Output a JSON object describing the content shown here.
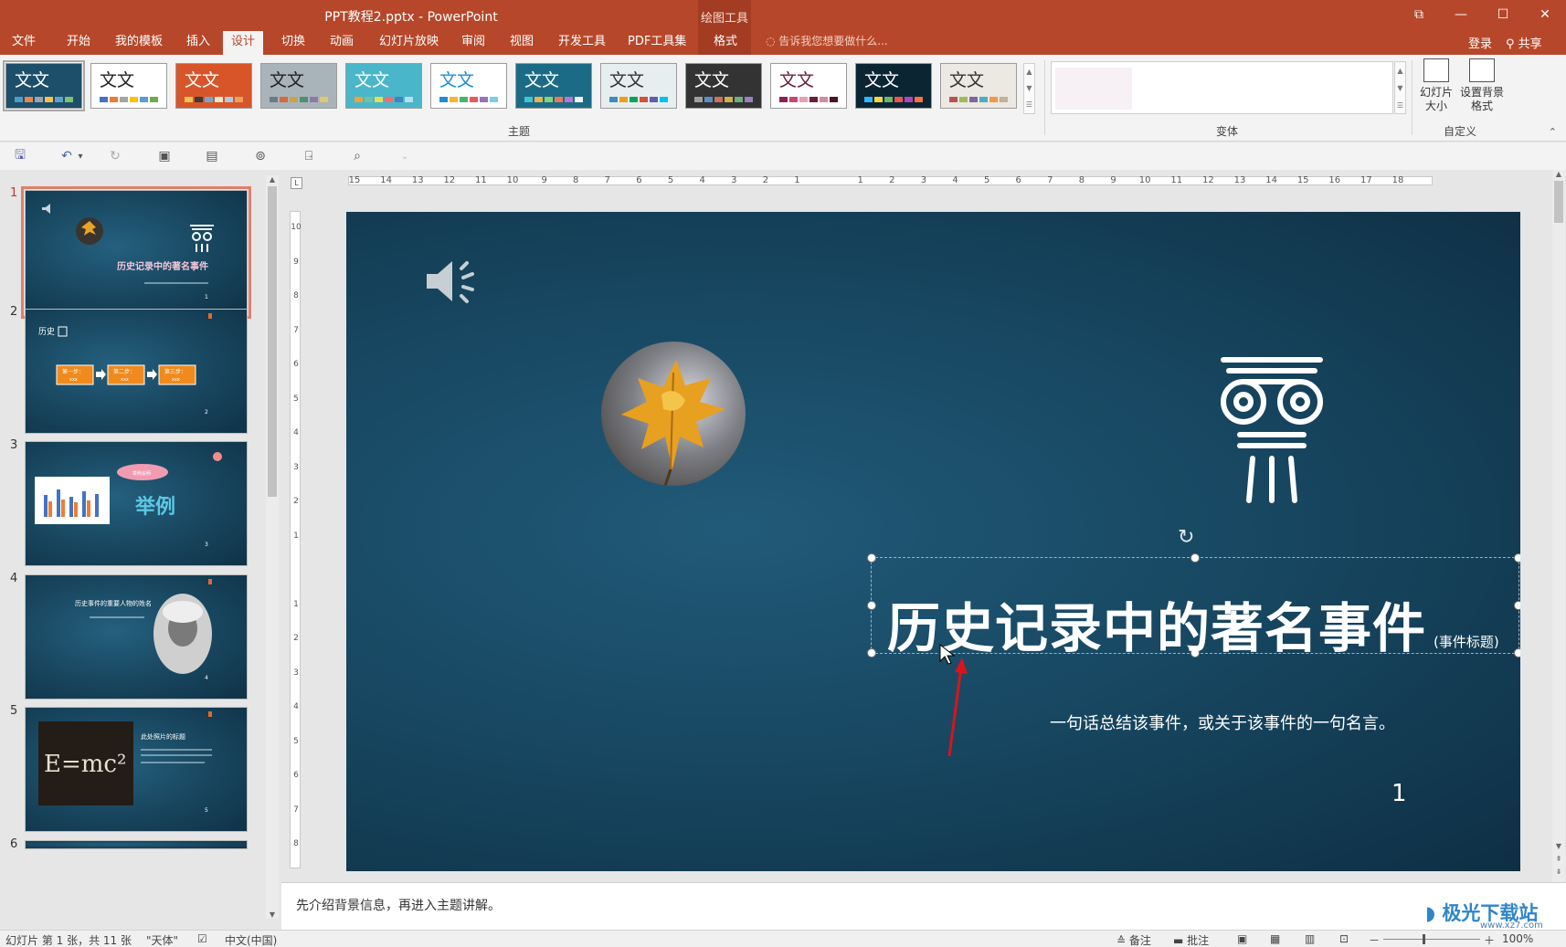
{
  "window": {
    "title": "PPT教程2.pptx - PowerPoint",
    "tools_group": "绘图工具",
    "restore_glyph": "⧉",
    "minimize_glyph": "—",
    "maximize_glyph": "☐",
    "close_glyph": "✕"
  },
  "tabs": [
    "文件",
    "开始",
    "我的模板",
    "插入",
    "设计",
    "切换",
    "动画",
    "幻灯片放映",
    "审阅",
    "视图",
    "开发工具",
    "PDF工具集",
    "格式"
  ],
  "active_tab": "设计",
  "tell_me": "告诉我您想要做什么...",
  "account": {
    "login": "登录",
    "share": "共享"
  },
  "ribbon": {
    "theme_label": "文文",
    "themes_group": "主题",
    "variants_group": "变体",
    "customize_group": "自定义",
    "slide_size_btn": "幻灯片大小",
    "format_bg_btn": "设置背景格式",
    "themes": [
      {
        "bg": "#1d4e6a",
        "text": "#ffffff",
        "sw": [
          "#4f9bd0",
          "#e8864a",
          "#9aa3b0",
          "#f3c24b",
          "#5ba3c9",
          "#7cc26f"
        ]
      },
      {
        "bg": "#ffffff",
        "text": "#222222",
        "sw": [
          "#4472c4",
          "#ed7d31",
          "#a5a5a5",
          "#ffc000",
          "#5b9bd5",
          "#70ad47"
        ]
      },
      {
        "bg": "#d8552a",
        "text": "#ffffff",
        "sw": [
          "#f2c14e",
          "#3b3b3b",
          "#7aa5c9",
          "#f0e4cc",
          "#b1cbe3",
          "#e5a35b"
        ]
      },
      {
        "bg": "#a9b4ba",
        "text": "#222222",
        "sw": [
          "#6b7b86",
          "#d46a3a",
          "#c7a44a",
          "#4d8f71",
          "#8d7aa8",
          "#e0c872"
        ]
      },
      {
        "bg": "#4ab6c9",
        "text": "#ffffff",
        "sw": [
          "#f29f3d",
          "#6dc2a9",
          "#e0e050",
          "#f36d6d",
          "#3e84c4",
          "#b3e0eb"
        ]
      },
      {
        "bg": "#ffffff",
        "text": "#1b8fd6",
        "sw": [
          "#1b8fd6",
          "#f9b233",
          "#44b56f",
          "#e75a5a",
          "#9a6fbf",
          "#7ccde6"
        ]
      },
      {
        "bg": "#1c6b86",
        "text": "#ffffff",
        "sw": [
          "#3fc4d8",
          "#e8b34a",
          "#8ad07f",
          "#e87a5a",
          "#b07ad0",
          "#f2f2f2"
        ]
      },
      {
        "bg": "#e7eef0",
        "text": "#333333",
        "sw": [
          "#3c8dbc",
          "#f39c12",
          "#00a65a",
          "#dd4b39",
          "#605ca8",
          "#00c0ef"
        ]
      },
      {
        "bg": "#333333",
        "text": "#ffffff",
        "sw": [
          "#a0a0a0",
          "#5a8fc8",
          "#c8735a",
          "#d0b04c",
          "#6fae7f",
          "#9a7fc1"
        ]
      },
      {
        "bg": "#ffffff",
        "text": "#6a1d3c",
        "sw": [
          "#8b2252",
          "#c9486e",
          "#e5a0b5",
          "#6a1d3c",
          "#d48a9f",
          "#4a1428"
        ]
      },
      {
        "bg": "#0c2533",
        "text": "#ffffff",
        "sw": [
          "#2eb8ff",
          "#fdd835",
          "#66bb6a",
          "#ef5350",
          "#ab47bc",
          "#ff7043"
        ]
      },
      {
        "bg": "#ece8e2",
        "text": "#333333",
        "sw": [
          "#c0504d",
          "#9bbb59",
          "#8064a2",
          "#4bacc6",
          "#f79646",
          "#c3b199"
        ]
      }
    ]
  },
  "qat": {
    "save_glyph": "🖫",
    "undo_glyph": "↶",
    "undo_menu_glyph": "▾",
    "redo_glyph": "↻",
    "new_slide_glyph": "▣",
    "layout_glyph": "▤",
    "from_start_glyph": "⊚",
    "present_glyph": "⍈",
    "preview_glyph": "⌕",
    "more_glyph": "⌄"
  },
  "slides_panel": {
    "numbers": [
      "1",
      "2",
      "3",
      "4",
      "5",
      "6"
    ],
    "slide2": {
      "title": "历史",
      "steps": [
        "第一步：\nxxx",
        "第二步：\nxxx",
        "第三步：\nxxx"
      ]
    },
    "slide3": {
      "bubble": "举例说明",
      "big_text": "举例"
    },
    "slide4": {
      "title": "历史事件的重要人物的姓名"
    },
    "slide5": {
      "formula": "E=mc²",
      "title": "此处照片的标题"
    }
  },
  "ruler": {
    "h_ticks": [
      "15",
      "14",
      "13",
      "12",
      "11",
      "10",
      "9",
      "8",
      "7",
      "6",
      "5",
      "4",
      "3",
      "2",
      "1",
      "",
      "1",
      "2",
      "3",
      "4",
      "5",
      "6",
      "7",
      "8",
      "9",
      "10",
      "11",
      "12",
      "13",
      "14",
      "15",
      "16",
      "17",
      "18"
    ],
    "v_ticks": [
      "10",
      "9",
      "8",
      "7",
      "6",
      "5",
      "4",
      "3",
      "2",
      "1",
      "",
      "1",
      "2",
      "3",
      "4",
      "5",
      "6",
      "7",
      "8"
    ]
  },
  "slide": {
    "title": "历史记录中的著名事件",
    "title_tag": "(事件标题)",
    "subtitle": "一句话总结该事件，或关于该事件的一句名言。",
    "slide_number": "1",
    "rotate_glyph": "↻"
  },
  "notes": "先介绍背景信息，再进入主题讲解。",
  "status": {
    "slide_info": "幻灯片 第 1 张，共 11 张",
    "theme_name": "\"天体\"",
    "language": "中文(中国)",
    "notes_btn": "备注",
    "comments_btn": "批注",
    "zoom": "100%",
    "zoom_out": "－",
    "zoom_in": "＋"
  },
  "watermark": {
    "name": "极光下载站",
    "url": "www.xz7.com"
  },
  "colors": {
    "brand": "#b7472a",
    "slide_bg": "#174660",
    "accent_orange": "#f08a1c"
  }
}
